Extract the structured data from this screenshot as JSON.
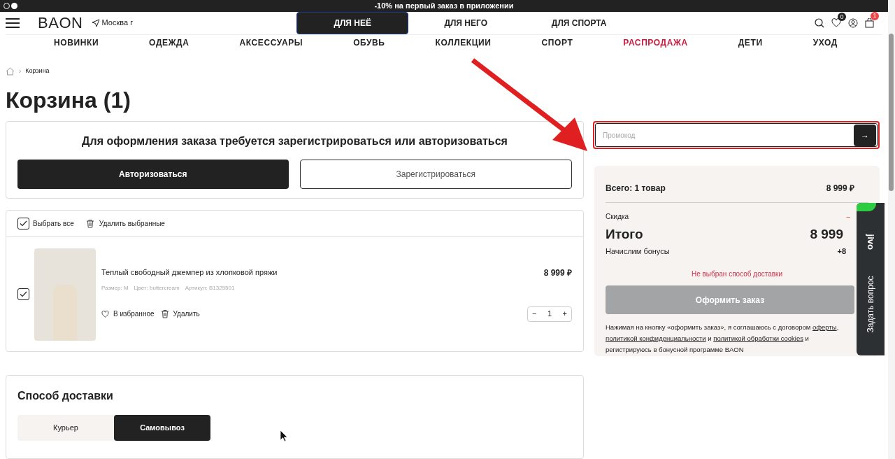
{
  "promo_banner": "-10% на первый заказ в приложении",
  "header": {
    "logo": "BAON",
    "location": "Москва г",
    "audience_tabs": [
      {
        "label": "ДЛЯ НЕЁ",
        "selected": true
      },
      {
        "label": "ДЛЯ НЕГО",
        "selected": false
      },
      {
        "label": "ДЛЯ СПОРТА",
        "selected": false
      }
    ],
    "wishlist_count": "0",
    "cart_count": "1"
  },
  "nav": [
    {
      "label": "НОВИНКИ",
      "highlight": false
    },
    {
      "label": "ОДЕЖДА",
      "highlight": false
    },
    {
      "label": "АКСЕССУАРЫ",
      "highlight": false
    },
    {
      "label": "ОБУВЬ",
      "highlight": false
    },
    {
      "label": "КОЛЛЕКЦИИ",
      "highlight": false
    },
    {
      "label": "СПОРТ",
      "highlight": false
    },
    {
      "label": "РАСПРОДАЖА",
      "highlight": true
    },
    {
      "label": "ДЕТИ",
      "highlight": false
    },
    {
      "label": "УХОД",
      "highlight": false
    }
  ],
  "breadcrumb": {
    "separator": "›",
    "items": [
      "Корзина"
    ]
  },
  "title": "Корзина (1)",
  "auth": {
    "message": "Для оформления заказа требуется зарегистрироваться или авторизоваться",
    "buttons": [
      {
        "label": "Авторизоваться",
        "kind": "primary"
      },
      {
        "label": "Зарегистрироваться",
        "kind": "outline"
      }
    ]
  },
  "cart": {
    "select_all": {
      "label": "Выбрать все",
      "checked": true
    },
    "delete_selected": "Удалить выбранные",
    "items": [
      {
        "name": "Теплый свободный джемпер из хлопковой пряжи",
        "size": "Размер: M",
        "shade": "Цвет: buttercream",
        "sku": "Артикул: B1325501",
        "price": "8 999 ₽",
        "checked": true,
        "favorite_label": "В избранное",
        "delete_label": "Удалить",
        "quantity": "1",
        "minus": "−",
        "plus": "+"
      }
    ]
  },
  "delivery": {
    "title": "Способ доставки",
    "options": [
      {
        "label": "Курьер",
        "selected": false
      },
      {
        "label": "Самовывоз",
        "selected": true
      }
    ]
  },
  "promo": {
    "placeholder": "Промокод",
    "button": "→"
  },
  "summary": {
    "total_label": "Всего: 1 товар",
    "total_value": "8 999 ₽",
    "discount_label": "Скидка",
    "discount_value": "–",
    "grand_label": "Итого",
    "grand_value": "8 999",
    "bonus_label": "Начислим бонусы",
    "bonus_value": "+8",
    "warning": "Не выбран способ доставки",
    "checkout": {
      "label": "Оформить заказ",
      "disabled": true
    },
    "legal": [
      {
        "kind": "text",
        "text": "Нажимая на кнопку «оформить заказ», я соглашаюсь с договором "
      },
      {
        "kind": "link",
        "text": "оферты"
      },
      {
        "kind": "text",
        "text": ", "
      },
      {
        "kind": "link",
        "text": "политикой конфиденциальности"
      },
      {
        "kind": "text",
        "text": " и "
      },
      {
        "kind": "link",
        "text": "политикой обработки cookies"
      },
      {
        "kind": "text",
        "text": " и регистрируюсь в бонусной программе BAON"
      }
    ]
  },
  "chat_widget": {
    "brand": "jivo",
    "label": "Задать вопрос"
  }
}
